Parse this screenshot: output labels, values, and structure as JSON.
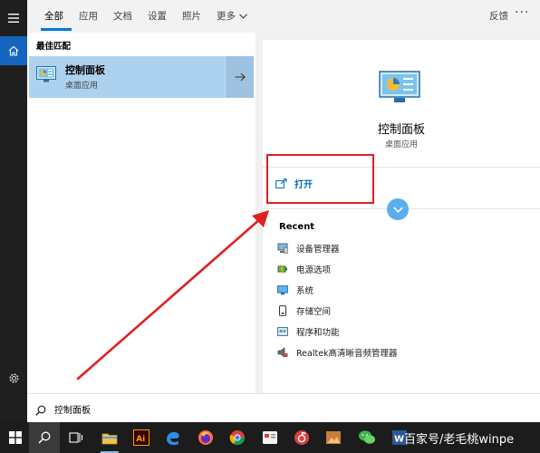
{
  "tabs": [
    {
      "label": "全部",
      "active": true
    },
    {
      "label": "应用"
    },
    {
      "label": "文档"
    },
    {
      "label": "设置"
    },
    {
      "label": "照片"
    },
    {
      "label": "更多"
    }
  ],
  "header": {
    "feedback_label": "反馈"
  },
  "results": {
    "section_title": "最佳匹配",
    "best_match": {
      "title": "控制面板",
      "subtitle": "桌面应用"
    }
  },
  "preview": {
    "title": "控制面板",
    "subtitle": "桌面应用",
    "open_label": "打开",
    "recent_title": "Recent",
    "recent_items": [
      {
        "label": "设备管理器",
        "icon": "device-manager-icon"
      },
      {
        "label": "电源选项",
        "icon": "power-options-icon"
      },
      {
        "label": "系统",
        "icon": "system-icon"
      },
      {
        "label": "存储空间",
        "icon": "storage-icon"
      },
      {
        "label": "程序和功能",
        "icon": "programs-icon"
      },
      {
        "label": "Realtek高清晰音频管理器",
        "icon": "realtek-audio-icon"
      }
    ]
  },
  "search": {
    "value": "控制面板"
  },
  "taskbar": {
    "apps": [
      "start",
      "search",
      "task-view",
      "file-explorer",
      "illustrator",
      "edge",
      "firefox",
      "chrome",
      "app",
      "netease-music",
      "photos",
      "wechat",
      "word"
    ],
    "ai_label": "Ai",
    "word_label": "W"
  },
  "watermark": "百家号/老毛桃winpe",
  "colors": {
    "accent": "#0078d7",
    "selection": "#add2ef",
    "annotation": "#e02020",
    "taskbar": "#1c1c1c"
  }
}
